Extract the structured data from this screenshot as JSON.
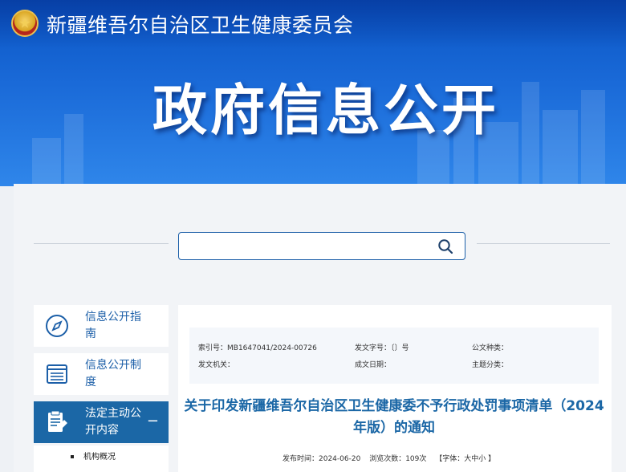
{
  "header": {
    "site_title": "新疆维吾尔自治区卫生健康委员会",
    "page_heading": "政府信息公开"
  },
  "search": {
    "placeholder": "",
    "icon": "search-icon"
  },
  "sidebar": {
    "items": [
      {
        "label": "信息公开指南",
        "icon": "compass-icon"
      },
      {
        "label": "信息公开制度",
        "icon": "document-list-icon"
      },
      {
        "label": "法定主动公开内容",
        "icon": "edit-document-icon",
        "toggle": "−"
      }
    ],
    "sub_items": [
      {
        "label": "机构概况"
      }
    ]
  },
  "meta": {
    "index_no": "索引号：MB1647041/2024-00726",
    "doc_no": "发文字号：〔〕号",
    "doc_type": "公文种类：",
    "issuer": "发文机关：",
    "date": "成文日期：",
    "topic": "主题分类："
  },
  "article": {
    "title": "关于印发新疆维吾尔自治区卫生健康委不予行政处罚事项清单（2024年版）的通知",
    "publish_time": "发布时间：2024-06-20",
    "views": "浏览次数：109次",
    "font_size": "【字体：大中小 】"
  },
  "colors": {
    "brand_blue": "#1b67a6",
    "banner_blue": "#1a6ad8"
  }
}
